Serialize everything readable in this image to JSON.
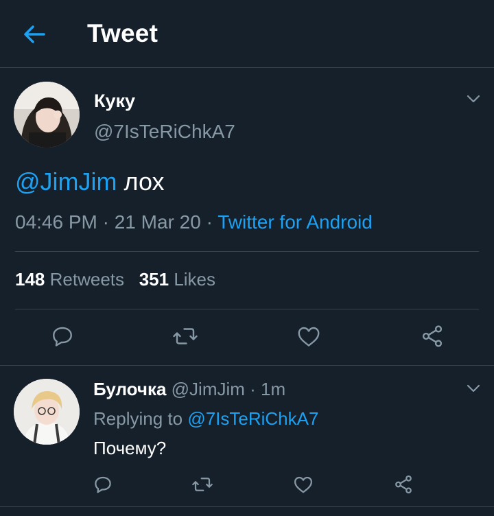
{
  "header": {
    "title": "Tweet"
  },
  "tweet": {
    "name": "Куку",
    "handle": "@7IsTeRiChkA7",
    "mention": "@JimJim",
    "text": " лох",
    "time": "04:46 PM · 21 Mar 20 · ",
    "source": "Twitter for Android",
    "retweets_count": "148",
    "retweets_label": "Retweets",
    "likes_count": "351",
    "likes_label": "Likes"
  },
  "reply": {
    "name": "Булочка",
    "handle": " @JimJim · 1m",
    "replying_to_label": "Replying to ",
    "replying_to_handle": "@7IsTeRiChkA7",
    "text": "Почему?"
  },
  "colors": {
    "background": "#15202b",
    "accent": "#1da1f2",
    "muted": "#8899a6",
    "divider": "#38444d"
  },
  "icons": [
    "back-arrow-icon",
    "chevron-down-icon",
    "reply-icon",
    "retweet-icon",
    "like-icon",
    "share-icon"
  ]
}
